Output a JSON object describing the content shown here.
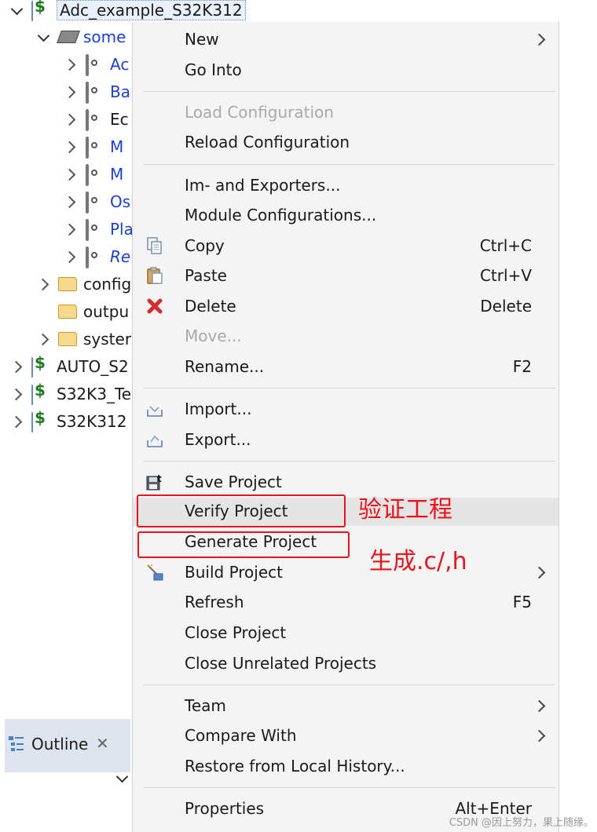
{
  "tree": {
    "root": "Adc_example_S32K312",
    "chip": "some",
    "components": [
      "Ac",
      "Ba",
      "Ec",
      "M",
      "M",
      "Os",
      "Pla",
      "Re"
    ],
    "folders": [
      "config",
      "outpu",
      "syster"
    ],
    "projects": [
      "AUTO_S2",
      "S32K3_Te",
      "S32K312"
    ]
  },
  "outline": {
    "title": "Outline"
  },
  "menu": {
    "new": "New",
    "go_into": "Go Into",
    "load_config": "Load Configuration",
    "reload_config": "Reload Configuration",
    "im_exporters": "Im- and Exporters...",
    "module_configs": "Module Configurations...",
    "copy": "Copy",
    "copy_sc": "Ctrl+C",
    "paste": "Paste",
    "paste_sc": "Ctrl+V",
    "delete": "Delete",
    "delete_sc": "Delete",
    "move": "Move...",
    "rename": "Rename...",
    "rename_sc": "F2",
    "import": "Import...",
    "export": "Export...",
    "save_project": "Save Project",
    "verify_project": "Verify Project",
    "generate_project": "Generate Project",
    "build_project": "Build Project",
    "refresh": "Refresh",
    "refresh_sc": "F5",
    "close_project": "Close Project",
    "close_unrelated": "Close Unrelated Projects",
    "team": "Team",
    "compare_with": "Compare With",
    "restore_history": "Restore from Local History...",
    "properties": "Properties",
    "properties_sc": "Alt+Enter"
  },
  "annotations": {
    "verify": "验证工程",
    "generate": "生成.c/,h"
  },
  "watermark": "CSDN @因上努力，果上随缘。",
  "colors": {
    "annotation_red": "#e8131b",
    "link_blue": "#1a3fd9"
  }
}
